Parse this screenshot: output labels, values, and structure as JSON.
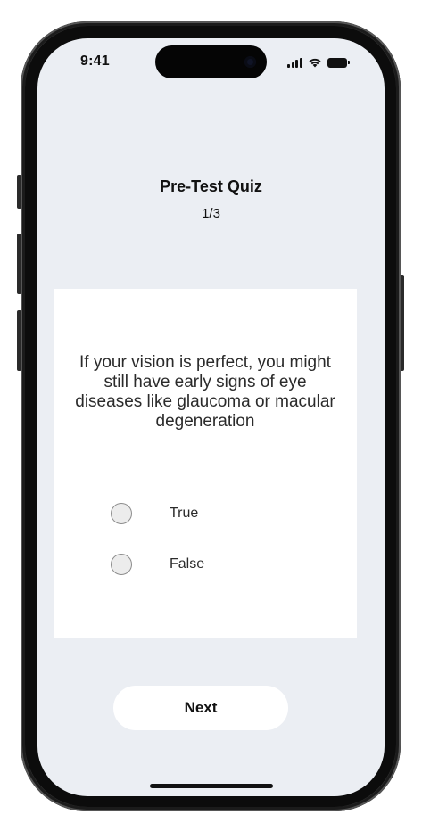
{
  "status_bar": {
    "time": "9:41",
    "icons": [
      "signal-icon",
      "wifi-icon",
      "battery-icon"
    ]
  },
  "quiz": {
    "title": "Pre-Test Quiz",
    "progress": "1/3",
    "question": "If your vision is perfect, you might still have early signs of eye diseases like glaucoma or macular degeneration",
    "options": [
      {
        "label": "True"
      },
      {
        "label": "False"
      }
    ]
  },
  "actions": {
    "next_label": "Next"
  },
  "colors": {
    "screen_background": "#ebeef3",
    "card_background": "#ffffff",
    "text": "#111111"
  }
}
